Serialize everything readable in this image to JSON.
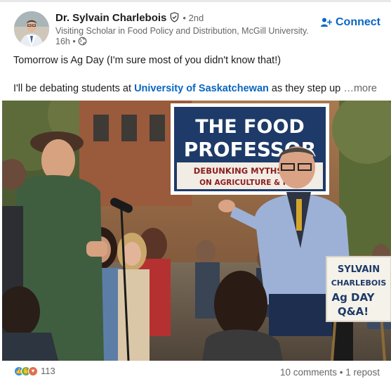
{
  "post": {
    "author_name": "Dr. Sylvain Charlebois",
    "degree": "• 2nd",
    "headline": "Visiting Scholar in Food Policy and Distribution, McGill University.",
    "time": "16h •",
    "connect_label": "Connect",
    "text_line1": "Tomorrow is Ag Day (I'm sure most of you didn't know that!)",
    "text_line2_prefix": "I'll be debating students at ",
    "text_line2_link": "University of Saskatchewan",
    "text_line2_suffix": " as they step up",
    "more_label": "…more",
    "accent_color": "#0a66c2"
  },
  "image": {
    "banner_title_line1": "THE FOOD",
    "banner_title_line2": "PROFESSOR",
    "banner_sub_line1": "DEBUNKING MYTHS & FA",
    "banner_sub_line2": "ON AGRICULTURE & FOO",
    "sign_line1": "SYLVAIN",
    "sign_line2": "CHARLEBOIS",
    "sign_line3": "Ag DAY",
    "sign_line4": "Q&A!"
  },
  "social": {
    "reaction_icons": [
      "like-icon",
      "support-icon",
      "love-icon"
    ],
    "reaction_count": "113",
    "stats": "10 comments • 1 repost"
  }
}
